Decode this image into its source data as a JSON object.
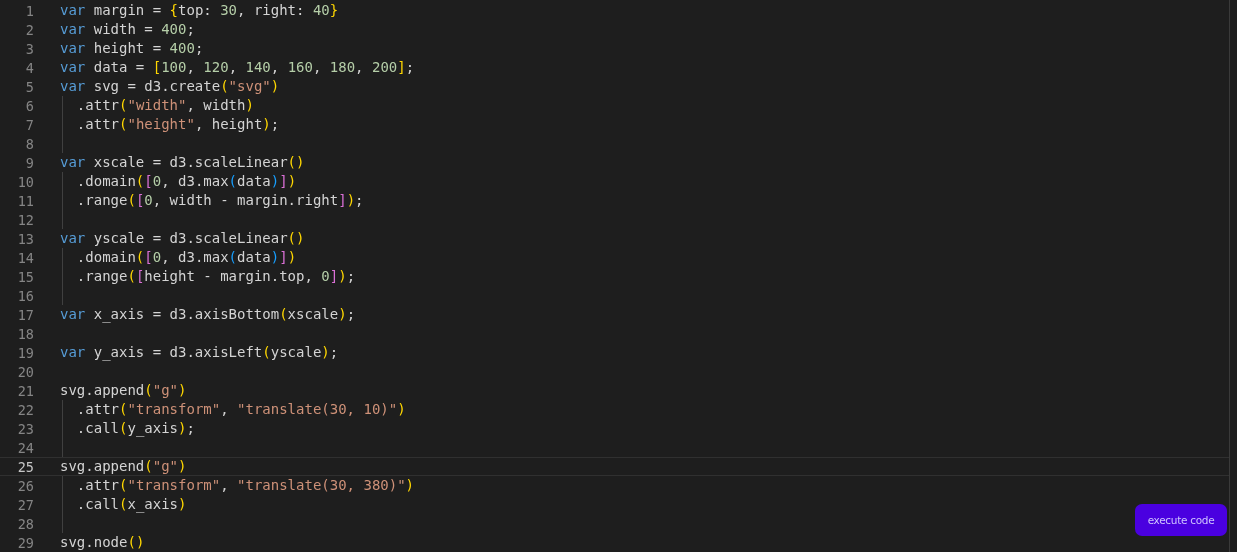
{
  "editor": {
    "lines": [
      {
        "number": "1",
        "current": false,
        "tokens": [
          {
            "kind": "keyword",
            "text": "var"
          },
          {
            "kind": "plain",
            "text": " margin = "
          },
          {
            "kind": "bracket1",
            "text": "{"
          },
          {
            "kind": "plain",
            "text": "top: "
          },
          {
            "kind": "number",
            "text": "30"
          },
          {
            "kind": "plain",
            "text": ", right: "
          },
          {
            "kind": "number",
            "text": "40"
          },
          {
            "kind": "bracket1",
            "text": "}"
          }
        ]
      },
      {
        "number": "2",
        "current": false,
        "tokens": [
          {
            "kind": "keyword",
            "text": "var"
          },
          {
            "kind": "plain",
            "text": " width = "
          },
          {
            "kind": "number",
            "text": "400"
          },
          {
            "kind": "plain",
            "text": ";"
          }
        ]
      },
      {
        "number": "3",
        "current": false,
        "tokens": [
          {
            "kind": "keyword",
            "text": "var"
          },
          {
            "kind": "plain",
            "text": " height = "
          },
          {
            "kind": "number",
            "text": "400"
          },
          {
            "kind": "plain",
            "text": ";"
          }
        ]
      },
      {
        "number": "4",
        "current": false,
        "tokens": [
          {
            "kind": "keyword",
            "text": "var"
          },
          {
            "kind": "plain",
            "text": " data = "
          },
          {
            "kind": "bracket1",
            "text": "["
          },
          {
            "kind": "number",
            "text": "100"
          },
          {
            "kind": "plain",
            "text": ", "
          },
          {
            "kind": "number",
            "text": "120"
          },
          {
            "kind": "plain",
            "text": ", "
          },
          {
            "kind": "number",
            "text": "140"
          },
          {
            "kind": "plain",
            "text": ", "
          },
          {
            "kind": "number",
            "text": "160"
          },
          {
            "kind": "plain",
            "text": ", "
          },
          {
            "kind": "number",
            "text": "180"
          },
          {
            "kind": "plain",
            "text": ", "
          },
          {
            "kind": "number",
            "text": "200"
          },
          {
            "kind": "bracket1",
            "text": "]"
          },
          {
            "kind": "plain",
            "text": ";"
          }
        ]
      },
      {
        "number": "5",
        "current": false,
        "tokens": [
          {
            "kind": "keyword",
            "text": "var"
          },
          {
            "kind": "plain",
            "text": " svg = d3.create"
          },
          {
            "kind": "bracket1",
            "text": "("
          },
          {
            "kind": "string",
            "text": "\"svg\""
          },
          {
            "kind": "bracket1",
            "text": ")"
          }
        ]
      },
      {
        "number": "6",
        "current": false,
        "tokens": [
          {
            "kind": "plain",
            "text": "  .attr"
          },
          {
            "kind": "bracket1",
            "text": "("
          },
          {
            "kind": "string",
            "text": "\"width\""
          },
          {
            "kind": "plain",
            "text": ", width"
          },
          {
            "kind": "bracket1",
            "text": ")"
          }
        ]
      },
      {
        "number": "7",
        "current": false,
        "tokens": [
          {
            "kind": "plain",
            "text": "  .attr"
          },
          {
            "kind": "bracket1",
            "text": "("
          },
          {
            "kind": "string",
            "text": "\"height\""
          },
          {
            "kind": "plain",
            "text": ", height"
          },
          {
            "kind": "bracket1",
            "text": ")"
          },
          {
            "kind": "plain",
            "text": ";"
          }
        ]
      },
      {
        "number": "8",
        "current": false
      },
      {
        "number": "9",
        "current": false,
        "tokens": [
          {
            "kind": "keyword",
            "text": "var"
          },
          {
            "kind": "plain",
            "text": " xscale = d3.scaleLinear"
          },
          {
            "kind": "bracket1",
            "text": "("
          },
          {
            "kind": "bracket1",
            "text": ")"
          }
        ]
      },
      {
        "number": "10",
        "current": false,
        "tokens": [
          {
            "kind": "plain",
            "text": "  .domain"
          },
          {
            "kind": "bracket1",
            "text": "("
          },
          {
            "kind": "bracket2",
            "text": "["
          },
          {
            "kind": "number",
            "text": "0"
          },
          {
            "kind": "plain",
            "text": ", d3.max"
          },
          {
            "kind": "bracket3",
            "text": "("
          },
          {
            "kind": "plain",
            "text": "data"
          },
          {
            "kind": "bracket3",
            "text": ")"
          },
          {
            "kind": "bracket2",
            "text": "]"
          },
          {
            "kind": "bracket1",
            "text": ")"
          }
        ]
      },
      {
        "number": "11",
        "current": false,
        "tokens": [
          {
            "kind": "plain",
            "text": "  .range"
          },
          {
            "kind": "bracket1",
            "text": "("
          },
          {
            "kind": "bracket2",
            "text": "["
          },
          {
            "kind": "number",
            "text": "0"
          },
          {
            "kind": "plain",
            "text": ", width - margin.right"
          },
          {
            "kind": "bracket2",
            "text": "]"
          },
          {
            "kind": "bracket1",
            "text": ")"
          },
          {
            "kind": "plain",
            "text": ";"
          }
        ]
      },
      {
        "number": "12",
        "current": false
      },
      {
        "number": "13",
        "current": false,
        "tokens": [
          {
            "kind": "keyword",
            "text": "var"
          },
          {
            "kind": "plain",
            "text": " yscale = d3.scaleLinear"
          },
          {
            "kind": "bracket1",
            "text": "("
          },
          {
            "kind": "bracket1",
            "text": ")"
          }
        ]
      },
      {
        "number": "14",
        "current": false,
        "tokens": [
          {
            "kind": "plain",
            "text": "  .domain"
          },
          {
            "kind": "bracket1",
            "text": "("
          },
          {
            "kind": "bracket2",
            "text": "["
          },
          {
            "kind": "number",
            "text": "0"
          },
          {
            "kind": "plain",
            "text": ", d3.max"
          },
          {
            "kind": "bracket3",
            "text": "("
          },
          {
            "kind": "plain",
            "text": "data"
          },
          {
            "kind": "bracket3",
            "text": ")"
          },
          {
            "kind": "bracket2",
            "text": "]"
          },
          {
            "kind": "bracket1",
            "text": ")"
          }
        ]
      },
      {
        "number": "15",
        "current": false,
        "tokens": [
          {
            "kind": "plain",
            "text": "  .range"
          },
          {
            "kind": "bracket1",
            "text": "("
          },
          {
            "kind": "bracket2",
            "text": "["
          },
          {
            "kind": "plain",
            "text": "height - margin.top, "
          },
          {
            "kind": "number",
            "text": "0"
          },
          {
            "kind": "bracket2",
            "text": "]"
          },
          {
            "kind": "bracket1",
            "text": ")"
          },
          {
            "kind": "plain",
            "text": ";"
          }
        ]
      },
      {
        "number": "16",
        "current": false
      },
      {
        "number": "17",
        "current": false,
        "tokens": [
          {
            "kind": "keyword",
            "text": "var"
          },
          {
            "kind": "plain",
            "text": " x_axis = d3.axisBottom"
          },
          {
            "kind": "bracket1",
            "text": "("
          },
          {
            "kind": "plain",
            "text": "xscale"
          },
          {
            "kind": "bracket1",
            "text": ")"
          },
          {
            "kind": "plain",
            "text": ";"
          }
        ]
      },
      {
        "number": "18",
        "current": false
      },
      {
        "number": "19",
        "current": false,
        "tokens": [
          {
            "kind": "keyword",
            "text": "var"
          },
          {
            "kind": "plain",
            "text": " y_axis = d3.axisLeft"
          },
          {
            "kind": "bracket1",
            "text": "("
          },
          {
            "kind": "plain",
            "text": "yscale"
          },
          {
            "kind": "bracket1",
            "text": ")"
          },
          {
            "kind": "plain",
            "text": ";"
          }
        ]
      },
      {
        "number": "20",
        "current": false
      },
      {
        "number": "21",
        "current": false,
        "tokens": [
          {
            "kind": "plain",
            "text": "svg.append"
          },
          {
            "kind": "bracket1",
            "text": "("
          },
          {
            "kind": "string",
            "text": "\"g\""
          },
          {
            "kind": "bracket1",
            "text": ")"
          }
        ]
      },
      {
        "number": "22",
        "current": false,
        "tokens": [
          {
            "kind": "plain",
            "text": "  .attr"
          },
          {
            "kind": "bracket1",
            "text": "("
          },
          {
            "kind": "string",
            "text": "\"transform\""
          },
          {
            "kind": "plain",
            "text": ", "
          },
          {
            "kind": "string",
            "text": "\"translate(30, 10)\""
          },
          {
            "kind": "bracket1",
            "text": ")"
          }
        ]
      },
      {
        "number": "23",
        "current": false,
        "tokens": [
          {
            "kind": "plain",
            "text": "  .call"
          },
          {
            "kind": "bracket1",
            "text": "("
          },
          {
            "kind": "plain",
            "text": "y_axis"
          },
          {
            "kind": "bracket1",
            "text": ")"
          },
          {
            "kind": "plain",
            "text": ";"
          }
        ]
      },
      {
        "number": "24",
        "current": false
      },
      {
        "number": "25",
        "current": true,
        "tokens": [
          {
            "kind": "plain",
            "text": "svg.append"
          },
          {
            "kind": "bracket1",
            "text": "("
          },
          {
            "kind": "string",
            "text": "\"g\""
          },
          {
            "kind": "bracket1",
            "text": ")"
          }
        ]
      },
      {
        "number": "26",
        "current": false,
        "tokens": [
          {
            "kind": "plain",
            "text": "  .attr"
          },
          {
            "kind": "bracket1",
            "text": "("
          },
          {
            "kind": "string",
            "text": "\"transform\""
          },
          {
            "kind": "plain",
            "text": ", "
          },
          {
            "kind": "string",
            "text": "\"translate(30, 380)\""
          },
          {
            "kind": "bracket1",
            "text": ")"
          }
        ]
      },
      {
        "number": "27",
        "current": false,
        "tokens": [
          {
            "kind": "plain",
            "text": "  .call"
          },
          {
            "kind": "bracket1",
            "text": "("
          },
          {
            "kind": "plain",
            "text": "x_axis"
          },
          {
            "kind": "bracket1",
            "text": ")"
          }
        ]
      },
      {
        "number": "28",
        "current": false
      },
      {
        "number": "29",
        "current": false,
        "tokens": [
          {
            "kind": "plain",
            "text": "svg.node"
          },
          {
            "kind": "bracket1",
            "text": "("
          },
          {
            "kind": "bracket1",
            "text": ")"
          }
        ]
      }
    ]
  },
  "execute_button": {
    "label": "execute code"
  }
}
